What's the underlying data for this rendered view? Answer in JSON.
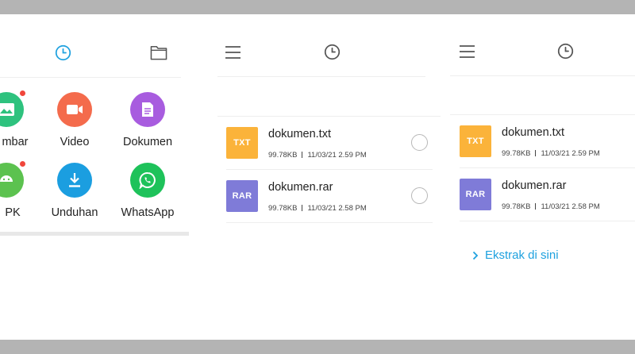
{
  "colors": {
    "accent": "#1ea1df",
    "icon_gray": "#555555",
    "txt_badge": "#fbb33a",
    "rar_badge": "#7f7bd8",
    "divider": "#eeeeee",
    "frame_band": "#b4b4b4"
  },
  "panel1": {
    "header_icons": [
      "clock-icon",
      "folder-icon"
    ],
    "categories": [
      {
        "label": "Gambar",
        "visible_label": "mbar",
        "icon": "image-icon",
        "color": "#2ec27e",
        "badge": true
      },
      {
        "label": "Video",
        "icon": "video-icon",
        "color": "#f46b4c",
        "badge": false
      },
      {
        "label": "Dokumen",
        "icon": "document-icon",
        "color": "#a85cdf",
        "badge": false
      },
      {
        "label": "APK",
        "visible_label": "PK",
        "icon": "android-icon",
        "color": "#5cc24f",
        "badge": true
      },
      {
        "label": "Unduhan",
        "icon": "download-icon",
        "color": "#1b9ee0",
        "badge": false
      },
      {
        "label": "WhatsApp",
        "icon": "whatsapp-icon",
        "color": "#1ec25a",
        "badge": false
      }
    ]
  },
  "panel2": {
    "header_icons": [
      "menu-icon",
      "clock-icon"
    ],
    "files": [
      {
        "name": "dokumen.txt",
        "type": "TXT",
        "size": "99.78KB",
        "date": "11/03/21 2.59 PM",
        "selected": false
      },
      {
        "name": "dokumen.rar",
        "type": "RAR",
        "size": "99.78KB",
        "date": "11/03/21 2.58 PM",
        "selected": false
      }
    ]
  },
  "panel3": {
    "header_icons": [
      "menu-icon",
      "clock-icon"
    ],
    "files": [
      {
        "name": "dokumen.txt",
        "type": "TXT",
        "size": "99.78KB",
        "date": "11/03/21 2.59 PM"
      },
      {
        "name": "dokumen.rar",
        "type": "RAR",
        "size": "99.78KB",
        "date": "11/03/21 2.58 PM"
      }
    ],
    "extract_label": "Ekstrak di sini"
  }
}
